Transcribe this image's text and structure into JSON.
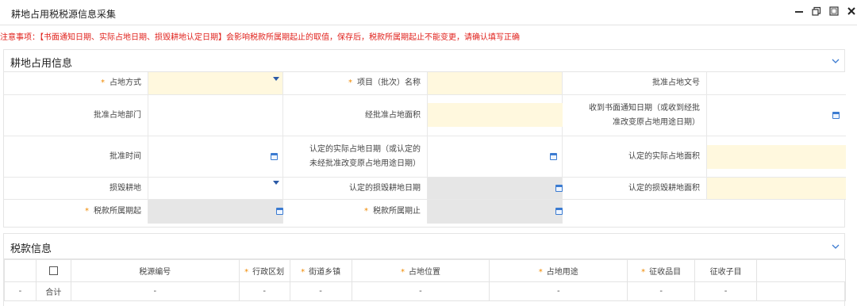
{
  "window": {
    "title": "耕地占用税税源信息采集"
  },
  "notice": "注意事项：【书面通知日期、实际占地日期、损毁耕地认定日期】会影响税款所属期起止的取值，保存后，税款所属期起止不能变更，请确认填写正确",
  "section1": {
    "title": "耕地占用信息",
    "fields": {
      "land_method": "占地方式",
      "project_name": "项目（批次）名称",
      "approval_doc": "批准占地文号",
      "approval_dept": "批准占地部门",
      "approved_area": "经批准占地面积",
      "notice_date_l1": "收到书面通知日期（或收到经批",
      "notice_date_l2": "准改变原占地用途日期）",
      "approval_time": "批准时间",
      "actual_date_l1": "认定的实际占地日期（或认定的",
      "actual_date_l2": "未经批准改变原占地用途日期）",
      "actual_area": "认定的实际占地面积",
      "damaged_land": "损毁耕地",
      "damaged_date": "认定的损毁耕地日期",
      "damaged_area": "认定的损毁耕地面积",
      "period_start": "税款所属期起",
      "period_end": "税款所属期止"
    }
  },
  "section2": {
    "title": "税款信息",
    "columns": [
      "税源编号",
      "行政区划",
      "街道乡镇",
      "占地位置",
      "占地用途",
      "征收品目",
      "征收子目"
    ],
    "required_columns": [
      false,
      true,
      true,
      true,
      true,
      true,
      false
    ],
    "total_row": {
      "marker": "-",
      "label": "合计",
      "values": [
        "-",
        "-",
        "-",
        "-",
        "-",
        "-",
        "-"
      ]
    }
  },
  "colors": {
    "required_bg": "#fff8de",
    "disabled_bg": "#e6e6e6",
    "notice": "#e0201b",
    "required_star": "#f08a00"
  }
}
